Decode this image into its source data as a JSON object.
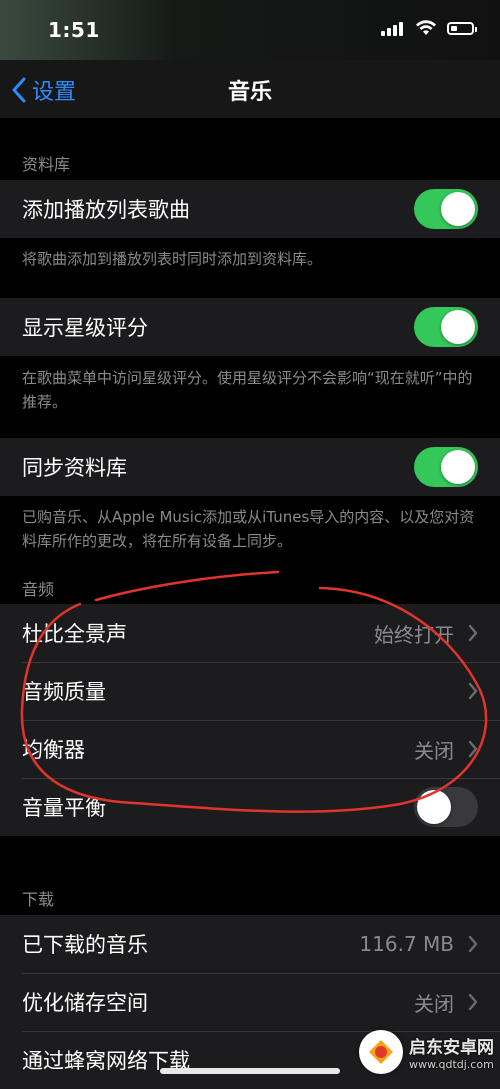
{
  "status_bar": {
    "time": "1:51",
    "icons": [
      "signal-icon",
      "wifi-icon",
      "battery-icon"
    ]
  },
  "nav": {
    "back_label": "设置",
    "title": "音乐",
    "back_icon": "chevron-left-icon",
    "accent_color": "#2f8cff"
  },
  "sections": {
    "library": {
      "label": "资料库",
      "add_playlist_songs": {
        "label": "添加播放列表歌曲",
        "on": true,
        "footnote": "将歌曲添加到播放列表时同时添加到资料库。"
      },
      "show_star_ratings": {
        "label": "显示星级评分",
        "on": true,
        "footnote": "在歌曲菜单中访问星级评分。使用星级评分不会影响“现在就听”中的推荐。"
      },
      "sync_library": {
        "label": "同步资料库",
        "on": true,
        "footnote": "已购音乐、从Apple Music添加或从iTunes导入的内容、以及您对资料库所作的更改，将在所有设备上同步。"
      }
    },
    "audio": {
      "label": "音频",
      "dolby_atmos": {
        "label": "杜比全景声",
        "value": "始终打开"
      },
      "audio_quality": {
        "label": "音频质量",
        "value": ""
      },
      "eq": {
        "label": "均衡器",
        "value": "关闭"
      },
      "sound_check": {
        "label": "音量平衡",
        "on": false
      }
    },
    "downloads": {
      "label": "下载",
      "downloaded_music": {
        "label": "已下载的音乐",
        "value": "116.7 MB"
      },
      "optimize_storage": {
        "label": "优化储存空间",
        "value": "关闭"
      },
      "cellular_download": {
        "label": "通过蜂窝网络下载"
      }
    }
  },
  "watermark": {
    "title": "启东安卓网",
    "url": "www.qdtdj.com"
  },
  "colors": {
    "toggle_on": "#34c759",
    "toggle_off": "#39393d",
    "cell_bg": "#1c1c1e",
    "annotation_red": "#e0342c"
  }
}
